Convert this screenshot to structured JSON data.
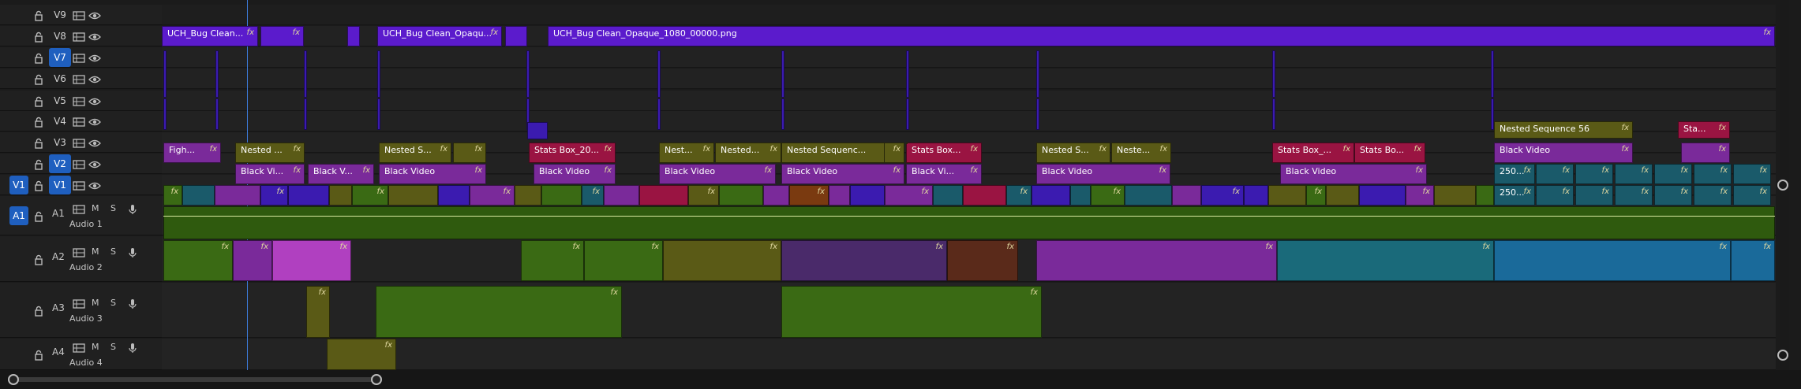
{
  "colors": {
    "accent": "#1f5fbf",
    "purple_v8": "#5b1bcc",
    "video_blue": "#3b1bb0",
    "olive": "#5a5a16",
    "magenta": "#7a2a9a",
    "crimson": "#9a1442",
    "green_audio": "#3a6a14",
    "teal": "#1a5a6a",
    "brown": "#7a3a10"
  },
  "video_tracks": [
    {
      "name": "V9",
      "source": ""
    },
    {
      "name": "V8",
      "source": ""
    },
    {
      "name": "V7",
      "source": "",
      "highlight": true
    },
    {
      "name": "V6",
      "source": ""
    },
    {
      "name": "V5",
      "source": ""
    },
    {
      "name": "V4",
      "source": ""
    },
    {
      "name": "V3",
      "source": ""
    },
    {
      "name": "V2",
      "source": "",
      "highlight": true
    },
    {
      "name": "V1",
      "source": "V1",
      "highlight": true
    }
  ],
  "audio_tracks": [
    {
      "name": "A1",
      "label": "Audio 1",
      "source": "A1"
    },
    {
      "name": "A2",
      "label": "Audio 2"
    },
    {
      "name": "A3",
      "label": "Audio 3"
    },
    {
      "name": "A4",
      "label": "Audio 4"
    }
  ],
  "audio_buttons": {
    "mute": "M",
    "solo": "S"
  },
  "clips": {
    "v8": [
      {
        "label": "UCH_Bug Clean...",
        "fx": "fx"
      },
      {
        "label": "",
        "fx": "fx"
      },
      {
        "label": "UCH_Bug Clean_Opaqu...",
        "fx": "fx"
      },
      {
        "label": "UCH_Bug Clean_Opaque_1080_00000.png",
        "fx": "fx"
      }
    ],
    "v4": [
      {
        "label": "Nested Sequence 56",
        "fx": "fx"
      },
      {
        "label": "Sta...",
        "fx": "fx"
      }
    ],
    "v3": [
      {
        "label": "Figh...",
        "fx": "fx"
      },
      {
        "label": "Nested ...",
        "fx": "fx"
      },
      {
        "label": "Nested S...",
        "fx": "fx"
      },
      {
        "label": "",
        "fx": "fx"
      },
      {
        "label": "Stats Box_20...",
        "fx": "fx"
      },
      {
        "label": "Nest...",
        "fx": "fx"
      },
      {
        "label": "Nested...",
        "fx": "fx"
      },
      {
        "label": "Nested Sequenc...",
        "fx": "fx"
      },
      {
        "label": "",
        "fx": "fx"
      },
      {
        "label": "Stats Box...",
        "fx": "fx"
      },
      {
        "label": "Nested S...",
        "fx": "fx"
      },
      {
        "label": "Neste...",
        "fx": "fx"
      },
      {
        "label": "Stats Box_...",
        "fx": "fx"
      },
      {
        "label": "Stats Bo...",
        "fx": "fx"
      },
      {
        "label": "Black Video",
        "fx": "fx"
      },
      {
        "label": "",
        "fx": "fx"
      }
    ],
    "v2": [
      {
        "label": "Black Vi...",
        "fx": "fx"
      },
      {
        "label": "Black V...",
        "fx": "fx"
      },
      {
        "label": "Black Video",
        "fx": "fx"
      },
      {
        "label": "Black Video",
        "fx": "fx"
      },
      {
        "label": "Black Video",
        "fx": "fx"
      },
      {
        "label": "Black Video",
        "fx": "fx"
      },
      {
        "label": "Black Vi...",
        "fx": "fx"
      },
      {
        "label": "Black Video",
        "fx": "fx"
      },
      {
        "label": "Black Video",
        "fx": "fx"
      },
      {
        "label": "250...",
        "fx": "fx"
      }
    ],
    "v1_right": {
      "label": "250...",
      "fx": "fx"
    }
  },
  "fx_label": "fx"
}
